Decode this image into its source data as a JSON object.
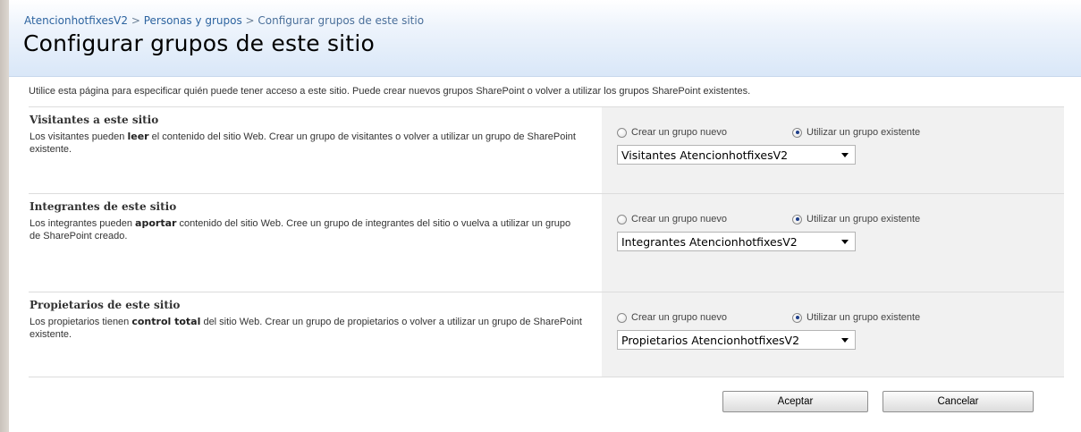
{
  "breadcrumb": {
    "site": "AtencionhotfixesV2",
    "sep1": " > ",
    "people": "Personas y grupos",
    "sep2": " > ",
    "current": "Configurar grupos de este sitio"
  },
  "page_title": "Configurar grupos de este sitio",
  "intro": "Utilice esta página para especificar quién puede tener acceso a este sitio. Puede crear nuevos grupos SharePoint o volver a utilizar los grupos SharePoint existentes.",
  "radio_labels": {
    "create": "Crear un grupo nuevo",
    "use_existing": "Utilizar un grupo existente"
  },
  "sections": [
    {
      "title": "Visitantes a este sitio",
      "text_before": "Los visitantes pueden ",
      "text_bold": "leer",
      "text_after": " el contenido del sitio Web. Crear un grupo de visitantes o volver a utilizar un grupo de SharePoint existente.",
      "selected_option": "use_existing",
      "group": "Visitantes AtencionhotfixesV2"
    },
    {
      "title": "Integrantes de este sitio",
      "text_before": "Los integrantes pueden ",
      "text_bold": "aportar",
      "text_after": " contenido del sitio Web. Cree un grupo de integrantes del sitio o vuelva a utilizar un grupo de SharePoint creado.",
      "selected_option": "use_existing",
      "group": "Integrantes AtencionhotfixesV2"
    },
    {
      "title": "Propietarios de este sitio",
      "text_before": "Los propietarios tienen ",
      "text_bold": "control total",
      "text_after": " del sitio Web. Crear un grupo de propietarios o volver a utilizar un grupo de SharePoint existente.",
      "selected_option": "use_existing",
      "group": "Propietarios AtencionhotfixesV2"
    }
  ],
  "buttons": {
    "ok": "Aceptar",
    "cancel": "Cancelar"
  }
}
